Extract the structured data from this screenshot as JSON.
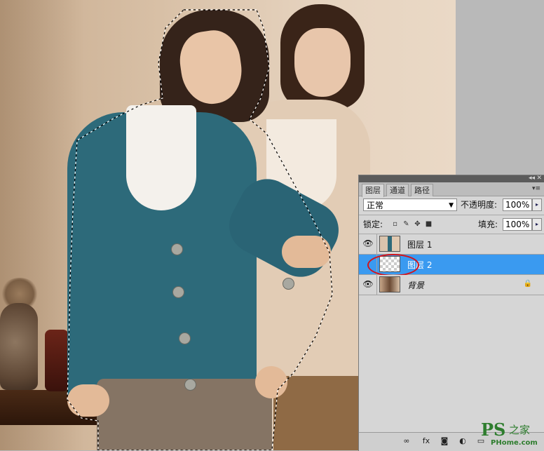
{
  "panel": {
    "tabs": [
      {
        "label": "图层"
      },
      {
        "label": "通道"
      },
      {
        "label": "路径"
      }
    ],
    "blend_mode": "正常",
    "opacity_label": "不透明度:",
    "opacity_value": "100%",
    "lock_label": "锁定:",
    "fill_label": "填充:",
    "fill_value": "100%",
    "layers": [
      {
        "name": "图层 1",
        "visible": true,
        "selected": false
      },
      {
        "name": "图层 2",
        "visible": false,
        "selected": true
      },
      {
        "name": "背景",
        "visible": true,
        "selected": false,
        "locked": true
      }
    ],
    "bottom_icons": [
      "link-icon",
      "fx-icon",
      "mask-icon",
      "adjustment-icon",
      "group-icon",
      "new-layer-icon",
      "trash-icon"
    ]
  },
  "watermark": {
    "ps": "PS",
    "cn": "之家",
    "url": "PHome.com"
  },
  "colors": {
    "selection_blue": "#3a9af0",
    "annotation_red": "#d3141b",
    "cardigan_teal": "#2d6a7a"
  }
}
